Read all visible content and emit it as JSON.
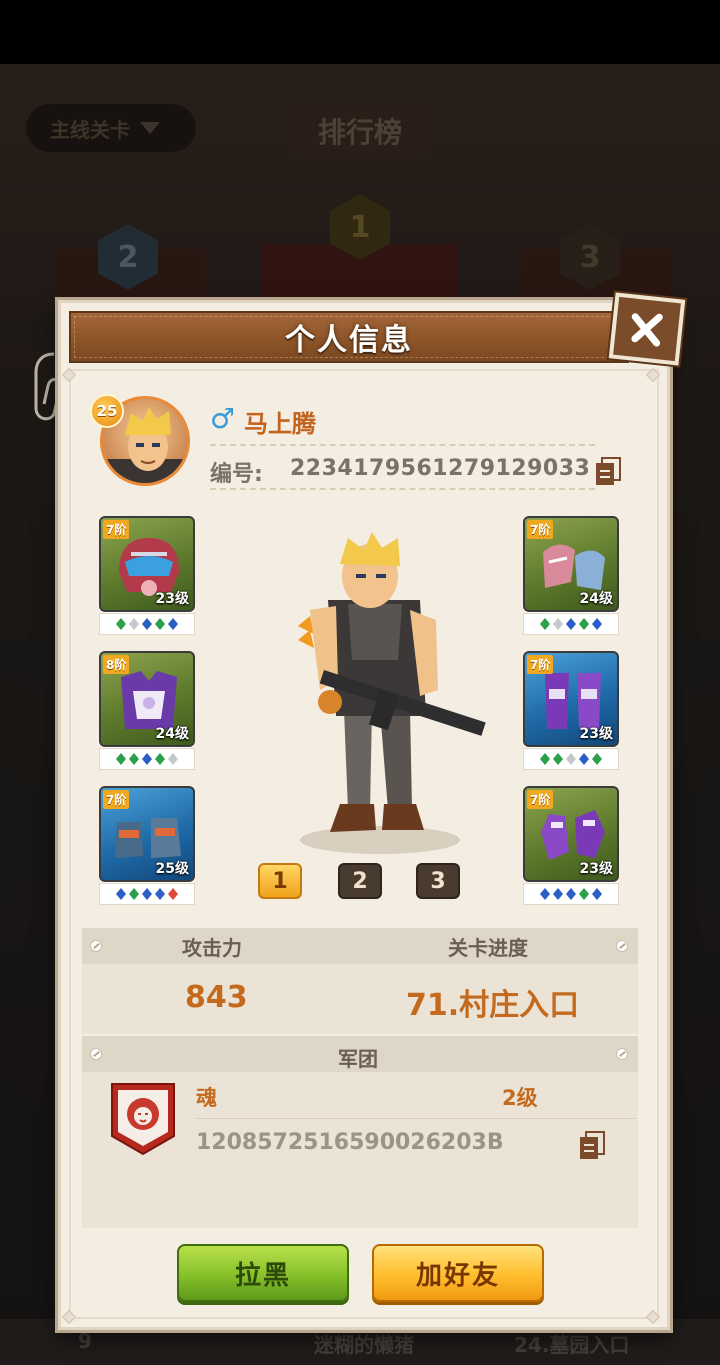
{
  "background": {
    "dropdown_label": "主线关卡",
    "title": "排行榜",
    "ranks": [
      "2",
      "1",
      "3"
    ],
    "bottom_row": {
      "rank": "9",
      "name": "迷糊的懒猪",
      "stage": "24.墓园入口"
    }
  },
  "modal": {
    "title": "个人信息",
    "close_icon": "close-x-icon"
  },
  "profile": {
    "level": "25",
    "gender_symbol": "♂",
    "name": "马上腾",
    "id_label": "编号:",
    "id_value": "2234179561279129033"
  },
  "equipment": {
    "left": [
      {
        "rank": "7阶",
        "level": "23级",
        "icon": "helmet-icon",
        "gems": [
          "g",
          "w",
          "b",
          "g",
          "b"
        ],
        "color": "green"
      },
      {
        "rank": "8阶",
        "level": "24级",
        "icon": "armor-icon",
        "gems": [
          "g",
          "g",
          "b",
          "g",
          "w"
        ],
        "color": "green"
      },
      {
        "rank": "7阶",
        "level": "25级",
        "icon": "boots-icon",
        "gems": [
          "b",
          "g",
          "b",
          "b",
          "r"
        ],
        "color": "blue"
      }
    ],
    "right": [
      {
        "rank": "7阶",
        "level": "24级",
        "icon": "shoulder-pad-icon",
        "gems": [
          "g",
          "w",
          "b",
          "g",
          "b"
        ],
        "color": "green"
      },
      {
        "rank": "7阶",
        "level": "23级",
        "icon": "leg-armor-icon",
        "gems": [
          "g",
          "g",
          "w",
          "b",
          "g"
        ],
        "color": "blue"
      },
      {
        "rank": "7阶",
        "level": "23级",
        "icon": "gloves-icon",
        "gems": [
          "b",
          "b",
          "b",
          "g",
          "b"
        ],
        "color": "green"
      }
    ]
  },
  "loadouts": [
    "1",
    "2",
    "3"
  ],
  "stats": {
    "attack_label": "攻击力",
    "attack_value": "843",
    "progress_label": "关卡进度",
    "progress_value": "71.村庄入口"
  },
  "guild": {
    "section_label": "军团",
    "name": "魂",
    "level": "2级",
    "id": "1208572516590026203B"
  },
  "buttons": {
    "block": "拉黑",
    "add_friend": "加好友"
  },
  "colors": {
    "accent_orange": "#c46a1e",
    "header_brown": "#8c5428",
    "button_green": "#86c02a",
    "button_yellow": "#ffbe2e"
  }
}
